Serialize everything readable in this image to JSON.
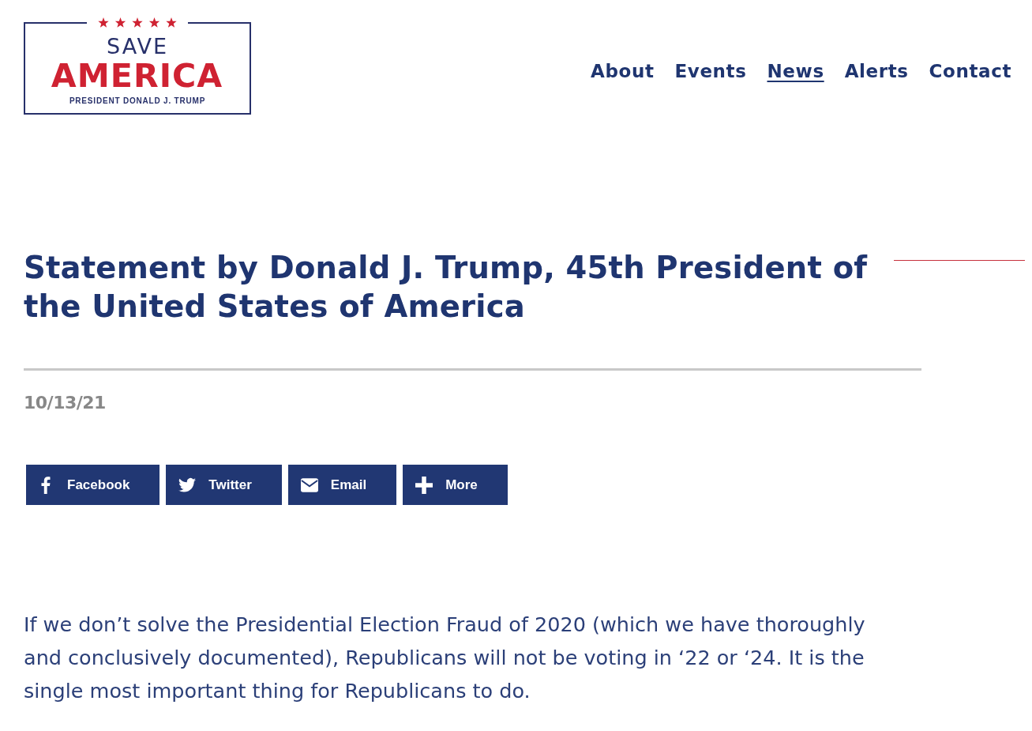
{
  "header": {
    "logo": {
      "line_1": "SAVE",
      "line_2": "AMERICA",
      "line_3": "PRESIDENT DONALD J. TRUMP"
    },
    "nav": [
      {
        "label": "About",
        "selected": false
      },
      {
        "label": "Events",
        "selected": false
      },
      {
        "label": "News",
        "selected": true
      },
      {
        "label": "Alerts",
        "selected": false
      },
      {
        "label": "Contact",
        "selected": false
      }
    ]
  },
  "article": {
    "title": "Statement by Donald J. Trump, 45th President of the United States of America",
    "date": "10/13/21",
    "share_buttons": [
      {
        "kind": "facebook",
        "label": "Facebook"
      },
      {
        "kind": "twitter",
        "label": "Twitter"
      },
      {
        "kind": "email",
        "label": "Email"
      },
      {
        "kind": "more",
        "label": "More"
      }
    ],
    "body": "If we don’t solve the Presidential Election Fraud of 2020 (which we have thoroughly and conclusively documented), Republicans will not be voting in ‘22 or ‘24. It is the single most important thing for Republicans to do."
  }
}
